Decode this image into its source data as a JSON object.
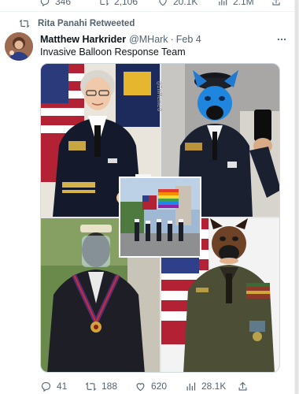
{
  "previous_tweet": {
    "replies": "346",
    "retweets": "2,106",
    "likes": "20.1K",
    "views": "2.1M"
  },
  "retweet_banner": {
    "text": "Rita Panahi Retweeted"
  },
  "tweet": {
    "author_name": "Matthew Harkrider",
    "handle": "@MHark",
    "date": "Feb 4",
    "text": "Invasive Balloon Response Team",
    "watermark": "@ImMeme0",
    "stats": {
      "replies": "41",
      "retweets": "188",
      "likes": "620",
      "views": "28.1K"
    }
  },
  "icons": {
    "reply": "reply-icon",
    "retweet": "retweet-icon",
    "like": "heart-icon",
    "views": "bar-chart-icon",
    "share": "share-icon",
    "more": "more-icon"
  },
  "colors": {
    "text_primary": "#0f1419",
    "text_secondary": "#536471",
    "border": "#cfd9de"
  }
}
